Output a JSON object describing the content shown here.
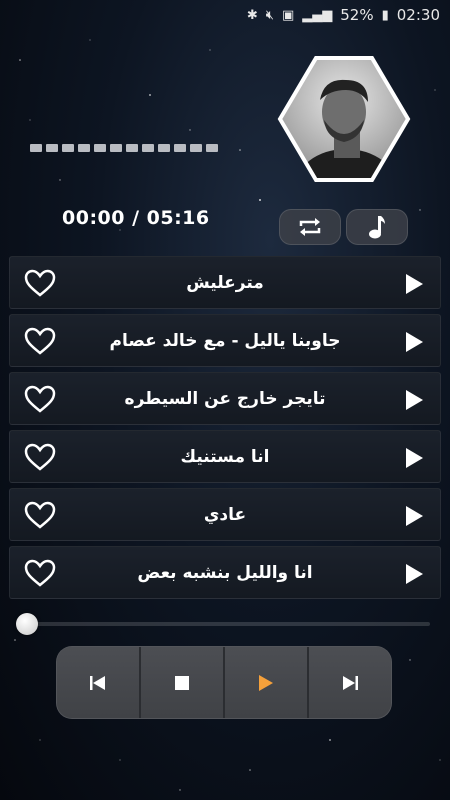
{
  "status_bar": {
    "battery": "52%",
    "time": "02:30",
    "icons": [
      "bluetooth-icon",
      "mute-icon",
      "nfc-icon",
      "signal-icon",
      "battery-icon"
    ]
  },
  "player": {
    "time_display": "00:00 / 05:16",
    "progress": 0.0,
    "icons": {
      "repeat": "repeat-icon",
      "music": "music-note-icon"
    }
  },
  "tracks": [
    {
      "title": "مترعليش"
    },
    {
      "title": "جاوبنا ياليل - مع خالد عصام"
    },
    {
      "title": "تايجر خارج عن السيطره"
    },
    {
      "title": "انا مستنيك"
    },
    {
      "title": "عادي"
    },
    {
      "title": "انا والليل بنشبه بعض"
    }
  ],
  "controls": {
    "icons": [
      "previous-icon",
      "stop-icon",
      "play-icon",
      "next-icon"
    ],
    "accent": "#f5a13b"
  }
}
